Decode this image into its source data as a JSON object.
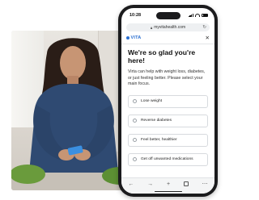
{
  "status_bar": {
    "time": "10:28"
  },
  "browser": {
    "url": "myvitahealth.com"
  },
  "site": {
    "logo_text": "VITA"
  },
  "main": {
    "greeting": "We're so glad you're here!",
    "intro": "Virta can help with weight loss, diabetes, or just feeling better. Please select your main focus.",
    "options": [
      {
        "label": "Lose weight"
      },
      {
        "label": "Reverse diabetes"
      },
      {
        "label": "Feel better, healthier"
      },
      {
        "label": "Get off unwanted medications"
      }
    ]
  },
  "icons": {
    "back": "back-arrow-icon",
    "forward": "forward-arrow-icon",
    "new_tab": "plus-icon",
    "tabs": "tabs-icon",
    "menu": "more-icon"
  },
  "colors": {
    "brand": "#2a6fd1",
    "phone_frame": "#1b1b1d",
    "shirt": "#2f4a72"
  }
}
